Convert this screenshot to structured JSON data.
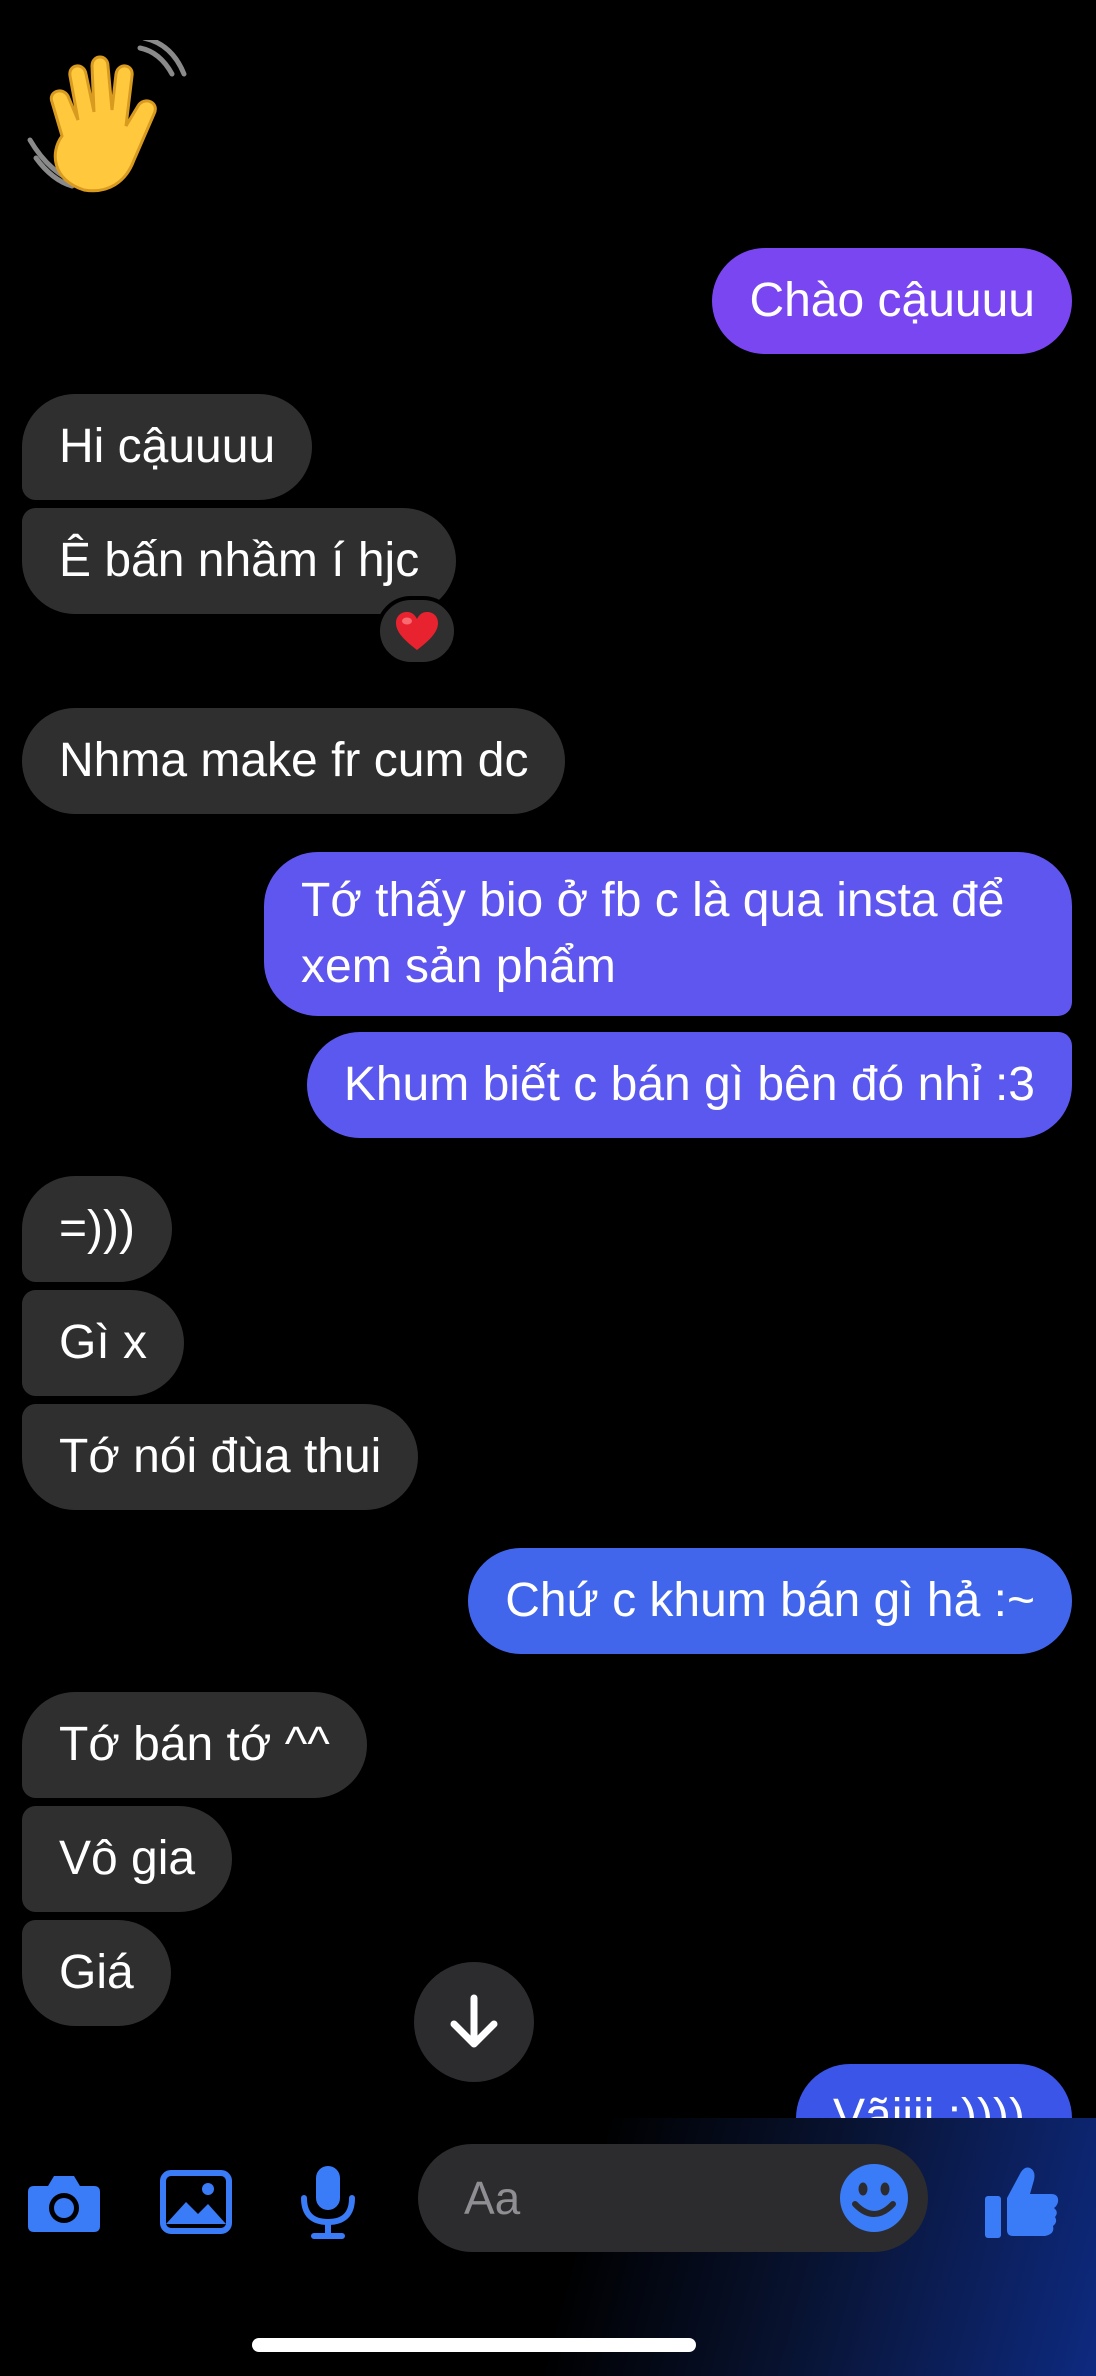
{
  "header_emoji": "waving-hand",
  "messages": [
    {
      "side": "out",
      "text": "Chào cậuuuu"
    },
    {
      "side": "in",
      "text": "Hi cậuuuu"
    },
    {
      "side": "in",
      "text": "Ê bấn nhầm í hjc",
      "reaction": "❤️"
    },
    {
      "side": "in",
      "text": "Nhma make fr cum dc"
    },
    {
      "side": "out",
      "text": "Tớ thấy bio ở fb c là qua insta để xem sản phẩm"
    },
    {
      "side": "out",
      "text": "Khum biết c bán gì bên đó nhỉ :3"
    },
    {
      "side": "in",
      "text": "=)))"
    },
    {
      "side": "in",
      "text": "Gì x"
    },
    {
      "side": "in",
      "text": "Tớ nói đùa thui"
    },
    {
      "side": "out",
      "text": "Chứ c khum bán gì hả :~"
    },
    {
      "side": "in",
      "text": "Tớ bán tớ ^^"
    },
    {
      "side": "in",
      "text": "Vô gia"
    },
    {
      "side": "in",
      "text": "Giá"
    },
    {
      "side": "out",
      "text": "Vãiiii :))))",
      "partial": true
    }
  ],
  "composer": {
    "placeholder": "Aa",
    "icons": [
      "camera-icon",
      "photo-icon",
      "microphone-icon",
      "emoji-icon",
      "like-icon"
    ]
  },
  "colors": {
    "background": "#000000",
    "incoming_bubble": "#2f2f2f",
    "outgoing_bubble_top": "#7a46f2",
    "outgoing_bubble_bottom": "#3a55e8",
    "accent": "#3a6ff0"
  }
}
